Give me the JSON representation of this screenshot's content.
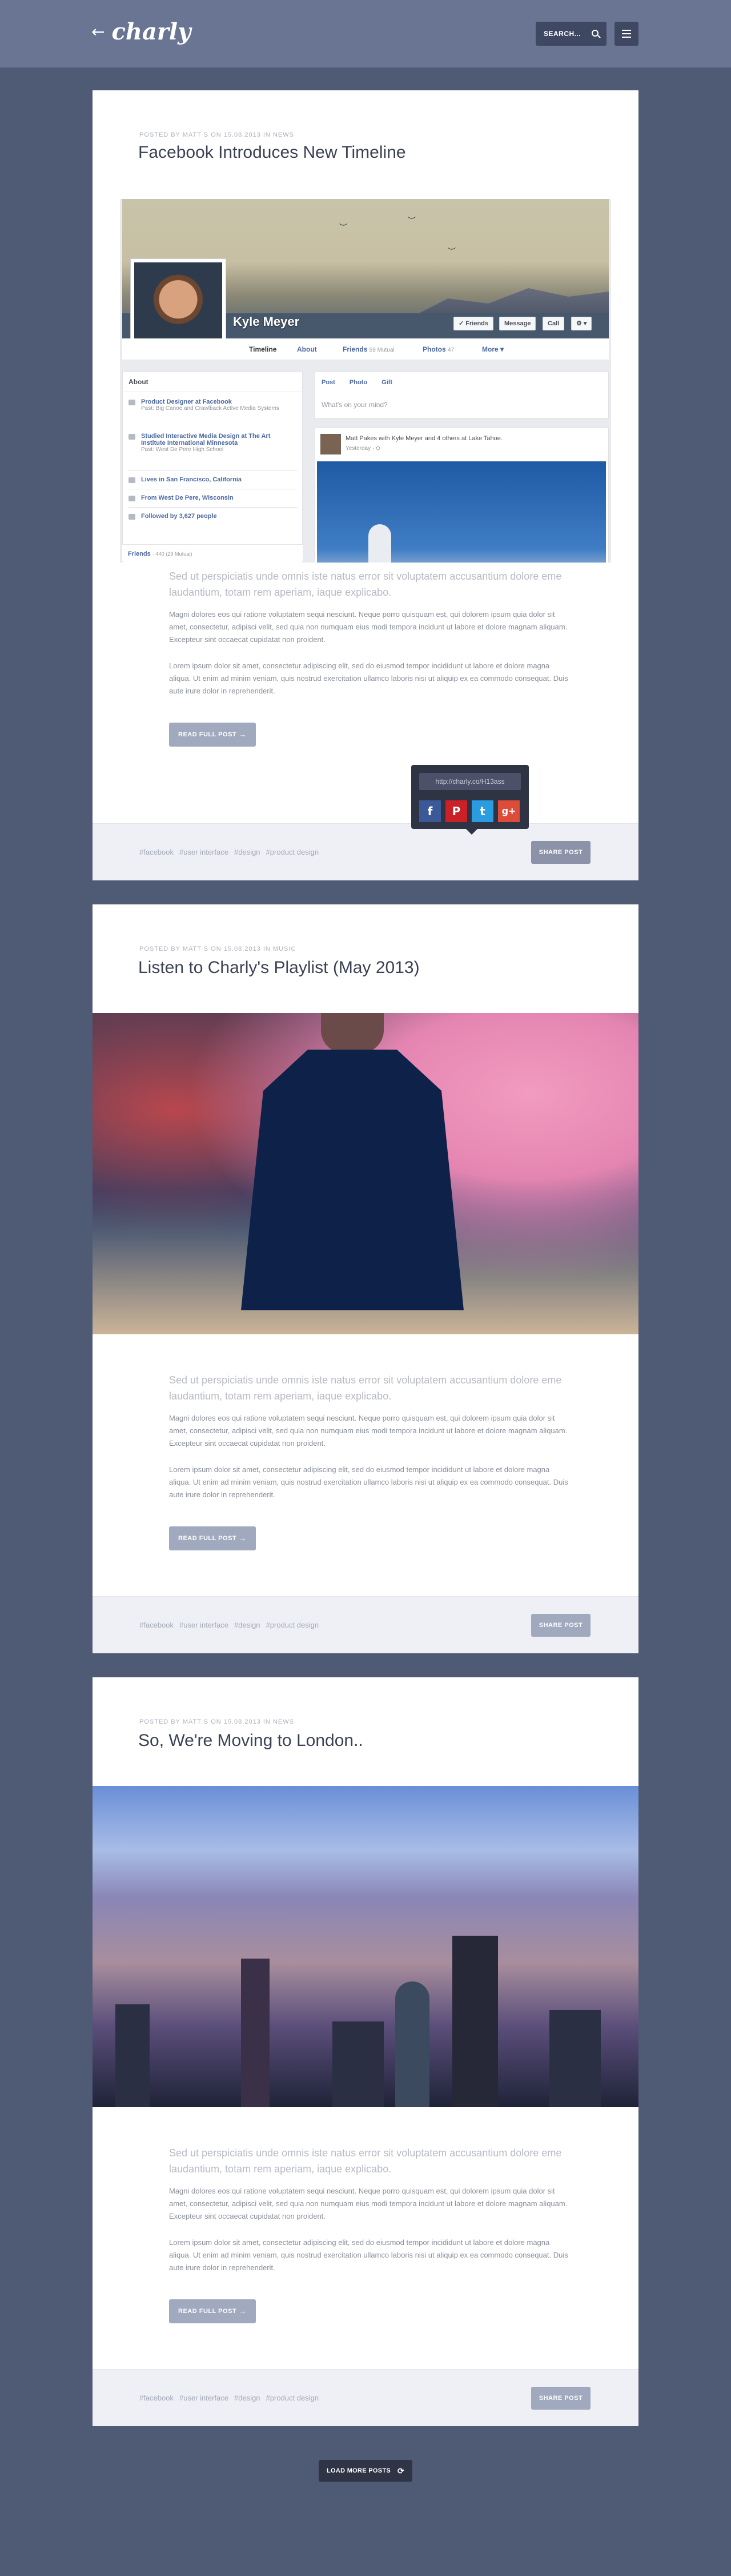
{
  "header": {
    "logo_text": "charly",
    "search_label": "SEARCH..."
  },
  "posts": [
    {
      "meta": "POSTED BY MATT S ON 15.08.2013 IN NEWS",
      "title": "Facebook Introduces New Timeline",
      "lead": "Sed ut perspiciatis unde omnis iste natus error sit voluptatem accusantium dolore eme laudantium, totam rem aperiam, iaque explicabo.",
      "para1": "Magni dolores eos qui ratione voluptatem sequi nesciunt. Neque porro quisquam est, qui dolorem ipsum quia dolor sit amet, consectetur, adipisci velit, sed quia non numquam eius modi tempora incidunt ut labore et dolore magnam aliquam. Excepteur sint occaecat cupidatat non proident.",
      "para2": "Lorem ipsum dolor sit amet, consectetur adipiscing elit, sed do eiusmod tempor incididunt ut labore et dolore magna aliqua. Ut enim ad minim veniam, quis nostrud exercitation ullamco laboris nisi ut aliquip ex ea commodo consequat. Duis aute irure dolor in reprehenderit.",
      "read_more": "READ FULL POST",
      "tags": [
        "#facebook",
        "#user interface",
        "#design",
        "#product design"
      ],
      "share": "SHARE POST"
    },
    {
      "meta": "POSTED BY MATT S ON 15.08.2013 IN MUSIC",
      "title": "Listen to Charly's Playlist (May 2013)",
      "lead": "Sed ut perspiciatis unde omnis iste natus error sit voluptatem accusantium dolore eme laudantium, totam rem aperiam, iaque explicabo.",
      "para1": "Magni dolores eos qui ratione voluptatem sequi nesciunt. Neque porro quisquam est, qui dolorem ipsum quia dolor sit amet, consectetur, adipisci velit, sed quia non numquam eius modi tempora incidunt ut labore et dolore magnam aliquam. Excepteur sint occaecat cupidatat non proident.",
      "para2": "Lorem ipsum dolor sit amet, consectetur adipiscing elit, sed do eiusmod tempor incididunt ut labore et dolore magna aliqua. Ut enim ad minim veniam, quis nostrud exercitation ullamco laboris nisi ut aliquip ex ea commodo consequat. Duis aute irure dolor in reprehenderit.",
      "read_more": "READ FULL POST",
      "tags": [
        "#facebook",
        "#user interface",
        "#design",
        "#product design"
      ],
      "share": "SHARE POST"
    },
    {
      "meta": "POSTED BY MATT S ON 15.08.2013 IN NEWS",
      "title": "So, We're Moving to London..",
      "lead": "Sed ut perspiciatis unde omnis iste natus error sit voluptatem accusantium dolore eme laudantium, totam rem aperiam, iaque explicabo.",
      "para1": "Magni dolores eos qui ratione voluptatem sequi nesciunt. Neque porro quisquam est, qui dolorem ipsum quia dolor sit amet, consectetur, adipisci velit, sed quia non numquam eius modi tempora incidunt ut labore et dolore magnam aliquam. Excepteur sint occaecat cupidatat non proident.",
      "para2": "Lorem ipsum dolor sit amet, consectetur adipiscing elit, sed do eiusmod tempor incididunt ut labore et dolore magna aliqua. Ut enim ad minim veniam, quis nostrud exercitation ullamco laboris nisi ut aliquip ex ea commodo consequat. Duis aute irure dolor in reprehenderit.",
      "read_more": "READ FULL POST",
      "tags": [
        "#facebook",
        "#user interface",
        "#design",
        "#product design"
      ],
      "share": "SHARE POST"
    }
  ],
  "share_popup": {
    "url": "http://charly.co/H13ass",
    "buttons": [
      {
        "label": "f",
        "icon": "facebook-icon",
        "color": "#3b5998"
      },
      {
        "label": "P",
        "icon": "pinterest-icon",
        "color": "#cb2027"
      },
      {
        "label": "t",
        "icon": "twitter-icon",
        "color": "#2a9ce0"
      },
      {
        "label": "g+",
        "icon": "google-plus-icon",
        "color": "#dd4b39"
      }
    ]
  },
  "facebook_mock": {
    "name": "Kyle Meyer",
    "btn_friends": "✓ Friends",
    "btn_message": "Message",
    "btn_call": "Call",
    "btn_gear": "⚙ ▾",
    "nav": [
      {
        "label": "Timeline",
        "count": ""
      },
      {
        "label": "About",
        "count": ""
      },
      {
        "label": "Friends",
        "count": "59 Mutual"
      },
      {
        "label": "Photos",
        "count": "47"
      },
      {
        "label": "More ▾",
        "count": ""
      }
    ],
    "about_title": "About",
    "about_rows": [
      {
        "main": "Product Designer at Facebook",
        "sub": "Past: Big Canoe and Crawlback Active Media Systems"
      },
      {
        "main": "Studied Interactive Media Design at The Art Institute International Minnesota",
        "sub": "Past: West De Pere High School"
      },
      {
        "main": "Lives in San Francisco, California",
        "sub": ""
      },
      {
        "main": "From West De Pere, Wisconsin",
        "sub": ""
      },
      {
        "main": "Followed by 3,627 people",
        "sub": ""
      }
    ],
    "friends_label": "Friends",
    "friends_count": "· 440 (29 Mutual)",
    "composer_actions": [
      "Post",
      "Photo",
      "Gift"
    ],
    "composer_placeholder": "What's on your mind?",
    "post_text": "Matt Pakes with Kyle Meyer and 4 others at Lake Tahoe.",
    "post_time": "Yesterday · ⛭"
  },
  "load_more": "LOAD MORE POSTS"
}
